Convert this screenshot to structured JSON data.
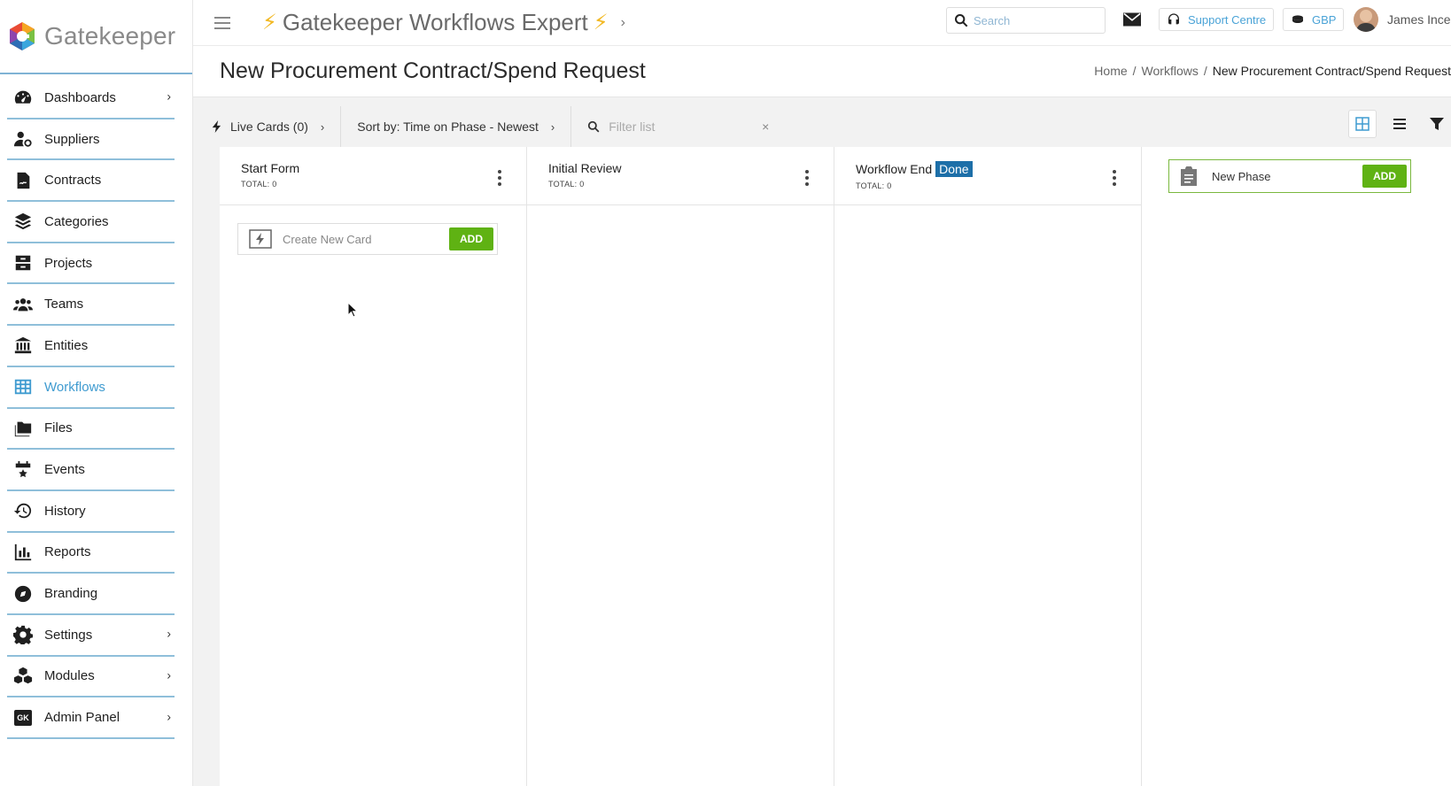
{
  "brand": {
    "name": "Gatekeeper"
  },
  "sidebar": {
    "items": [
      {
        "label": "Dashboards",
        "has_chevron": true
      },
      {
        "label": "Suppliers"
      },
      {
        "label": "Contracts"
      },
      {
        "label": "Categories"
      },
      {
        "label": "Projects"
      },
      {
        "label": "Teams"
      },
      {
        "label": "Entities"
      },
      {
        "label": "Workflows",
        "active": true
      },
      {
        "label": "Files"
      },
      {
        "label": "Events"
      },
      {
        "label": "History"
      },
      {
        "label": "Reports"
      },
      {
        "label": "Branding"
      },
      {
        "label": "Settings",
        "has_chevron": true
      },
      {
        "label": "Modules",
        "has_chevron": true
      },
      {
        "label": "Admin Panel",
        "has_chevron": true,
        "badge": "GK"
      }
    ],
    "chevron": "›"
  },
  "topbar": {
    "workflow_title": "Gatekeeper Workflows Expert",
    "bolt": "⚡",
    "chevron": "›",
    "search_placeholder": "Search",
    "support_label": "Support Centre",
    "currency_label": "GBP",
    "user_name": "James Ince"
  },
  "page": {
    "title": "New Procurement Contract/Spend Request",
    "breadcrumb": {
      "home": "Home",
      "sep": "/",
      "workflows": "Workflows",
      "current": "New Procurement Contract/Spend Request"
    }
  },
  "toolbar": {
    "live_cards": "Live Cards (0)",
    "sort_by": "Sort by: Time on Phase - Newest",
    "chevron": "›",
    "filter_placeholder": "Filter list",
    "clear": "×"
  },
  "columns": [
    {
      "title": "Start Form",
      "total": "TOTAL: 0"
    },
    {
      "title": "Initial Review",
      "total": "TOTAL: 0"
    },
    {
      "title": "Workflow End",
      "badge": "Done",
      "total": "TOTAL: 0"
    }
  ],
  "create_card": {
    "placeholder": "Create New Card",
    "button": "ADD"
  },
  "new_phase": {
    "placeholder": "New Phase",
    "button": "ADD"
  },
  "colors": {
    "accent_blue": "#3f9bd0",
    "add_green": "#5fb213",
    "done_badge": "#1d6fa8",
    "bolt_yellow": "#f2b822"
  }
}
